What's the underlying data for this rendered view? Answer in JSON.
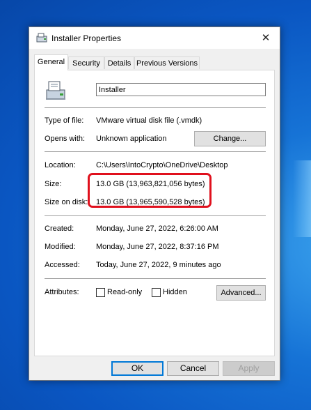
{
  "window": {
    "title": "Installer Properties",
    "close_label": "✕"
  },
  "tabs": [
    {
      "label": "General"
    },
    {
      "label": "Security"
    },
    {
      "label": "Details"
    },
    {
      "label": "Previous Versions"
    }
  ],
  "general": {
    "file_name": "Installer",
    "type_label": "Type of file:",
    "type_value": "VMware virtual disk file (.vmdk)",
    "opens_label": "Opens with:",
    "opens_value": "Unknown application",
    "change_button": "Change...",
    "location_label": "Location:",
    "location_value": "C:\\Users\\IntoCrypto\\OneDrive\\Desktop",
    "size_label": "Size:",
    "size_value": "13.0 GB (13,963,821,056 bytes)",
    "size_on_disk_label": "Size on disk:",
    "size_on_disk_value": "13.0 GB (13,965,590,528 bytes)",
    "created_label": "Created:",
    "created_value": "Monday, June 27, 2022, 6:26:00 AM",
    "modified_label": "Modified:",
    "modified_value": "Monday, June 27, 2022, 8:37:16 PM",
    "accessed_label": "Accessed:",
    "accessed_value": "Today, June 27, 2022, 9 minutes ago",
    "attributes_label": "Attributes:",
    "readonly_label": "Read-only",
    "hidden_label": "Hidden",
    "advanced_button": "Advanced..."
  },
  "footer": {
    "ok": "OK",
    "cancel": "Cancel",
    "apply": "Apply"
  },
  "colors": {
    "highlight": "#e0101d",
    "desktop": "#0a56c2",
    "ok_border": "#0078d7"
  },
  "icons": {
    "title": "file-properties-icon",
    "file": "installer-file-icon"
  }
}
